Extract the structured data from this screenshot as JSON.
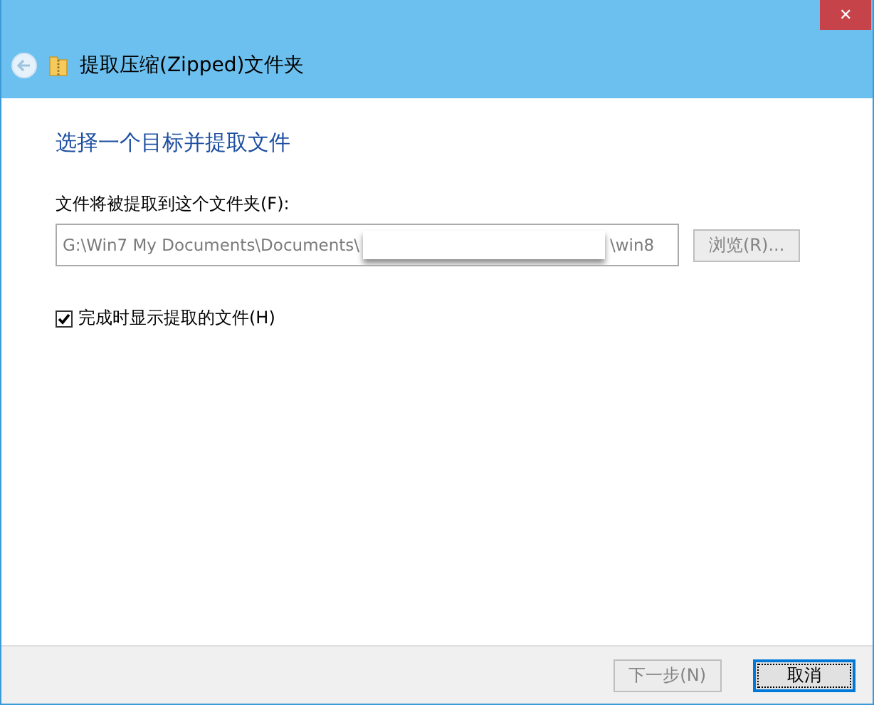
{
  "window": {
    "title": "提取压缩(Zipped)文件夹",
    "close": "✕"
  },
  "heading": "选择一个目标并提取文件",
  "destination": {
    "label": "文件将被提取到这个文件夹(F):",
    "value_start": "G:\\Win7 My Documents\\Documents\\",
    "value_end": "\\win8",
    "redacted": true
  },
  "browse_button": {
    "label": "浏览(R)...",
    "disabled": true
  },
  "show_files_checkbox": {
    "label": "完成时显示提取的文件(H)",
    "checked": true
  },
  "buttons": [
    {
      "label": "下一步(N)",
      "disabled": true,
      "focused": false
    },
    {
      "label": "取消",
      "disabled": false,
      "focused": true
    }
  ]
}
